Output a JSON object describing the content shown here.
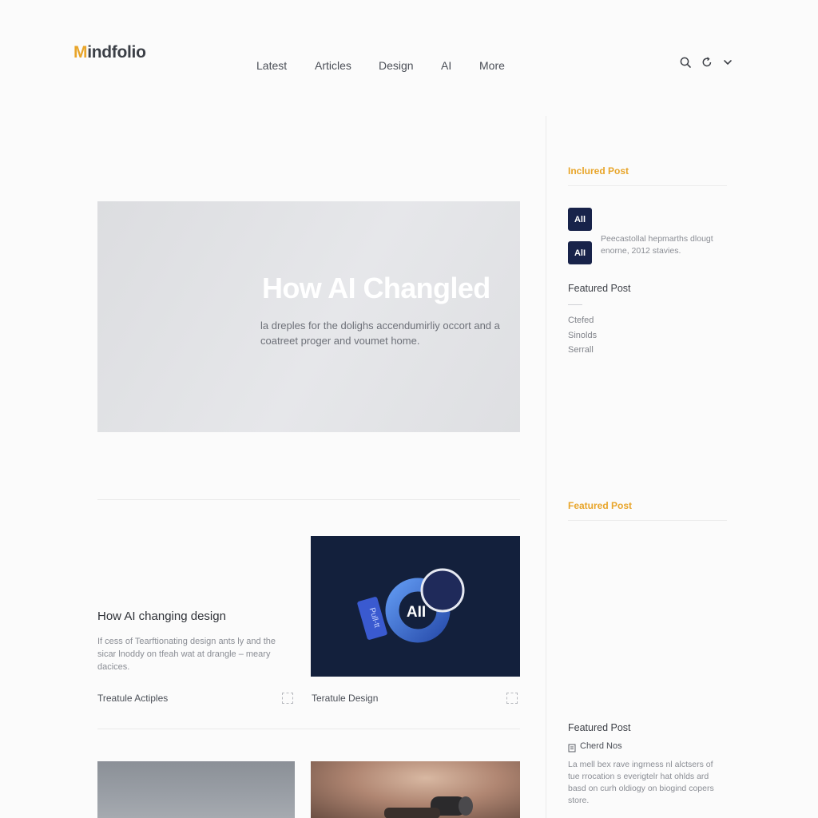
{
  "brand": {
    "logo_first": "M",
    "logo_rest": "indfolio"
  },
  "nav": [
    "Latest",
    "Articles",
    "Design",
    "AI",
    "More"
  ],
  "header_icons": [
    "search-icon",
    "refresh-icon",
    "chevron-down-icon"
  ],
  "hero": {
    "title": "How AI Changled",
    "description": "la dreples for the dolighs accendumirliy occort and a coatreet proger and voumet home."
  },
  "articles": [
    {
      "title": "How AI changing design",
      "description": "If cess of Tearftionating design ants ly and the sicar lnoddy on tfeah wat at drangle – meary dacices.",
      "category": "Treatule Actiples"
    },
    {
      "image_badge": "AII",
      "card_label": "Pull-tt",
      "category": "Teratule Design"
    }
  ],
  "sidebar": {
    "included_post": {
      "heading": "Inclured Post",
      "badges": [
        "All",
        "AlI"
      ],
      "text": "Peecastollal hepmarths dlougt enorne, 2012 stavies."
    },
    "featured_post": {
      "heading": "Featured Post",
      "links": [
        "Ctefed",
        "Sinolds",
        "Serrall"
      ]
    },
    "featured_post_gold": {
      "heading": "Featured Post"
    },
    "featured_post_bottom": {
      "heading": "Featured Post",
      "item_label": "Cherd Nos",
      "text": "La mell bex rave ingrness nl alctsers of tue rrocation s everigtelr hat ohlds ard basd on curh oldiogy on biogind copers store."
    }
  },
  "colors": {
    "accent": "#e8a52a",
    "navy": "#18234a",
    "ring_blue": "#4a7fdc"
  }
}
